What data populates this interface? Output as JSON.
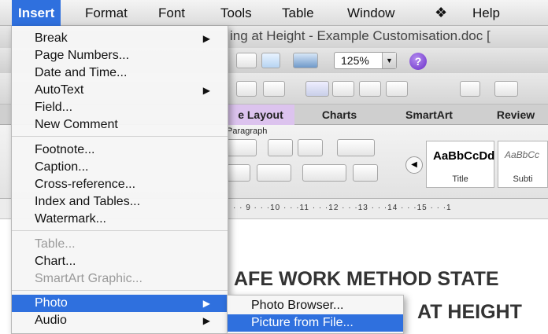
{
  "menubar": {
    "items": [
      "Insert",
      "Format",
      "Font",
      "Tools",
      "Table",
      "Window",
      "Help"
    ],
    "script_icon": "script-menu-icon"
  },
  "window": {
    "title": "ing at Height - Example Customisation.doc [",
    "zoom": "125%",
    "ribbon_tabs": [
      "e Layout",
      "Charts",
      "SmartArt",
      "Review"
    ],
    "selected_tab": "e Layout",
    "paragraph_group": "Paragraph",
    "styles": [
      {
        "sample": "AaBbCcDd",
        "name": "Title"
      },
      {
        "sample": "AaBbCc",
        "name": "Subti"
      }
    ],
    "ruler": "· · 9 · · ·10 · · ·11 · · ·12 · · ·13 · · ·14 · · ·15 · · ·1"
  },
  "document": {
    "heading1": "AFE WORK METHOD STATE",
    "heading2": "AT HEIGHT"
  },
  "insert_menu": {
    "items": [
      {
        "label": "Break",
        "submenu": true,
        "disabled": false
      },
      {
        "label": "Page Numbers...",
        "submenu": false,
        "disabled": false
      },
      {
        "label": "Date and Time...",
        "submenu": false,
        "disabled": false
      },
      {
        "label": "AutoText",
        "submenu": true,
        "disabled": false
      },
      {
        "label": "Field...",
        "submenu": false,
        "disabled": false
      },
      {
        "label": "New Comment",
        "submenu": false,
        "disabled": false
      },
      {
        "label": "Footnote...",
        "submenu": false,
        "disabled": false
      },
      {
        "label": "Caption...",
        "submenu": false,
        "disabled": false
      },
      {
        "label": "Cross-reference...",
        "submenu": false,
        "disabled": false
      },
      {
        "label": "Index and Tables...",
        "submenu": false,
        "disabled": false
      },
      {
        "label": "Watermark...",
        "submenu": false,
        "disabled": false
      },
      {
        "label": "Table...",
        "submenu": false,
        "disabled": true
      },
      {
        "label": "Chart...",
        "submenu": false,
        "disabled": false
      },
      {
        "label": "SmartArt Graphic...",
        "submenu": false,
        "disabled": true
      },
      {
        "label": "Photo",
        "submenu": true,
        "disabled": false,
        "highlighted": true
      },
      {
        "label": "Audio",
        "submenu": true,
        "disabled": false
      }
    ]
  },
  "photo_submenu": {
    "items": [
      {
        "label": "Photo Browser...",
        "highlighted": false
      },
      {
        "label": "Picture from File...",
        "highlighted": true
      }
    ]
  },
  "colors": {
    "highlight": "#2f70de",
    "tab_selected": "#dcc3ee"
  }
}
